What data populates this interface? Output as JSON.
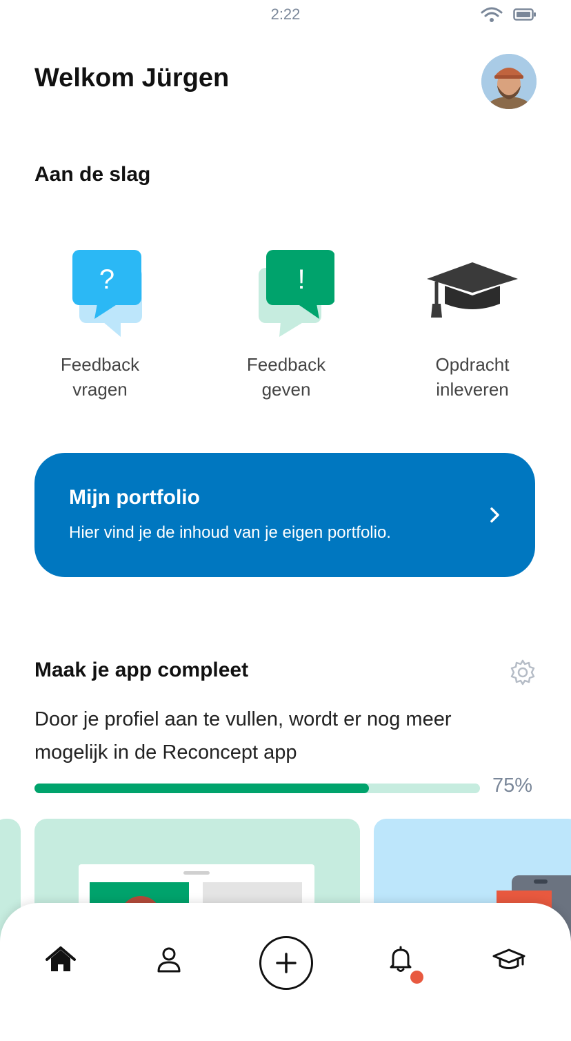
{
  "status": {
    "time": "2:22"
  },
  "header": {
    "welcome": "Welkom Jürgen"
  },
  "start": {
    "title": "Aan de slag",
    "actions": [
      {
        "label_line1": "Feedback",
        "label_line2": "vragen",
        "icon": "question-bubble-icon",
        "color": "#2bb8f5"
      },
      {
        "label_line1": "Feedback",
        "label_line2": "geven",
        "icon": "exclamation-bubble-icon",
        "color": "#00a36c"
      },
      {
        "label_line1": "Opdracht",
        "label_line2": "inleveren",
        "icon": "graduation-cap-icon",
        "color": "#3a3a3a"
      }
    ]
  },
  "portfolio": {
    "title": "Mijn portfolio",
    "subtitle": "Hier vind je de inhoud van je eigen portfolio.",
    "color": "#0077c0"
  },
  "complete": {
    "title": "Maak je app compleet",
    "description": "Door je profiel aan te vullen, wordt er nog meer mogelijk in de Reconcept app",
    "progress_percent": 75,
    "progress_label": "75%"
  },
  "nav": {
    "items": [
      "home-icon",
      "profile-icon",
      "add-icon",
      "notifications-icon",
      "education-icon"
    ],
    "notification_dot_color": "#e8593f"
  }
}
